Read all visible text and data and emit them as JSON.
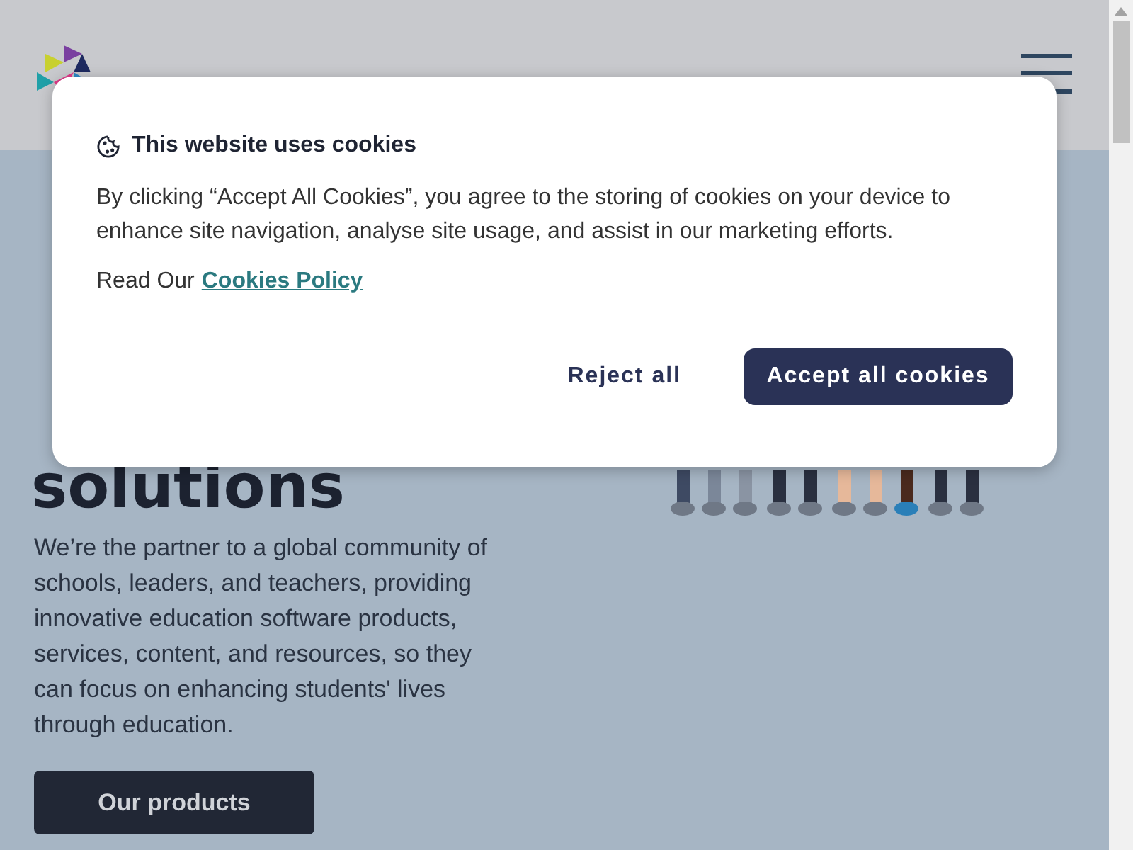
{
  "hero": {
    "heading_lines": [
      "solutions"
    ],
    "paragraph": "We’re the partner to a global community of schools, leaders, and teachers, providing innovative education software products, services, content, and resources, so they can focus on enhancing students' lives through education.",
    "button": "Our products"
  },
  "cookie_dialog": {
    "title": "This website uses cookies",
    "body": "By clicking “Accept All Cookies”, you agree to the storing of cookies on your device to enhance site navigation, analyse site usage, and assist in our marketing efforts.",
    "policy_prefix": "Read Our",
    "policy_link": "Cookies Policy",
    "buttons": [
      {
        "label": "Reject all",
        "kind": "text"
      },
      {
        "label": "Accept all cookies",
        "kind": "primary"
      }
    ]
  }
}
